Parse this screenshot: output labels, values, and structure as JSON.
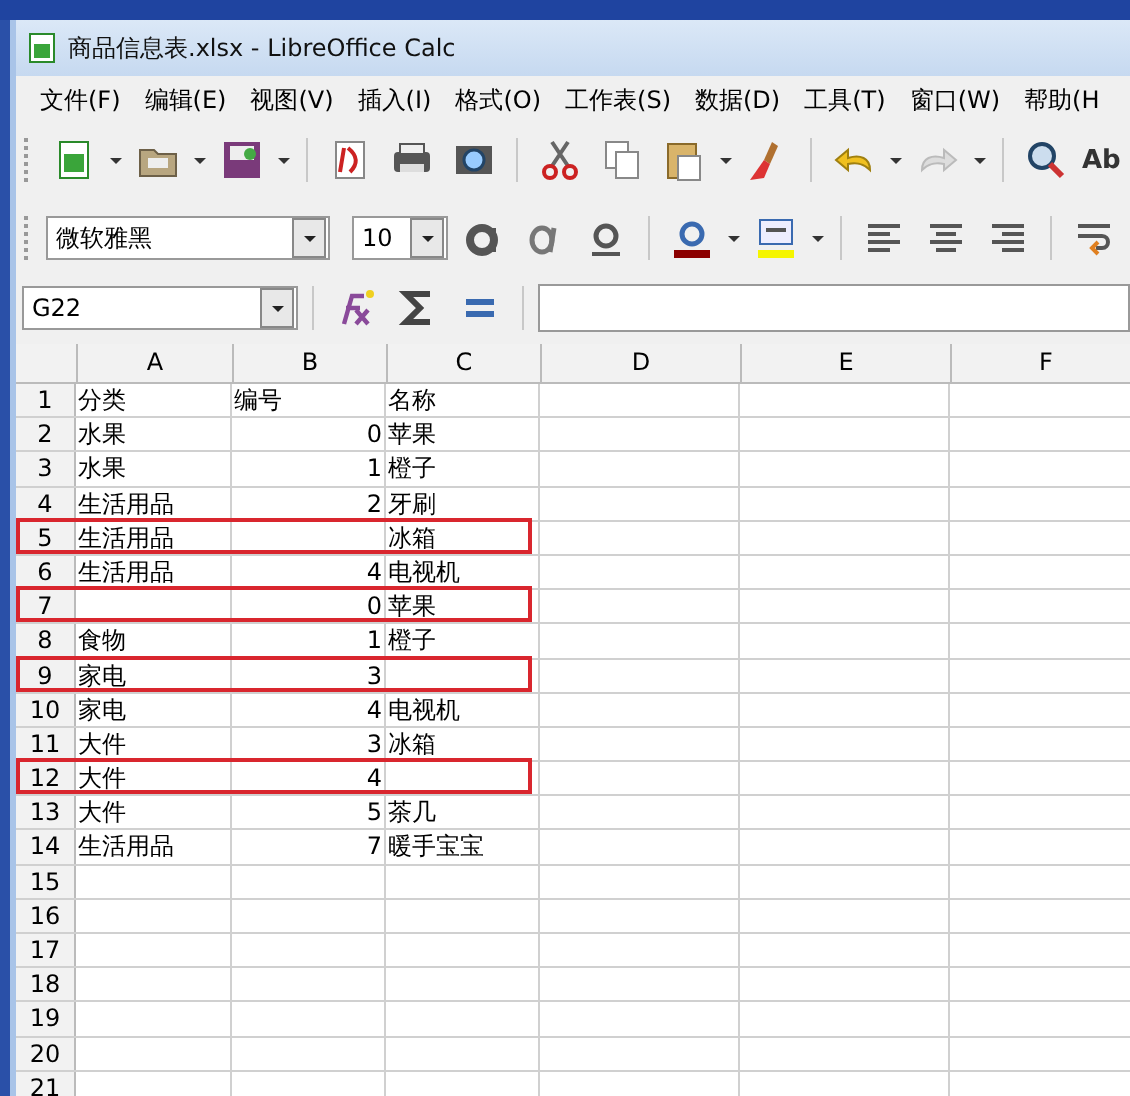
{
  "window": {
    "title": "商品信息表.xlsx - LibreOffice Calc"
  },
  "menu": [
    "文件(F)",
    "编辑(E)",
    "视图(V)",
    "插入(I)",
    "格式(O)",
    "工作表(S)",
    "数据(D)",
    "工具(T)",
    "窗口(W)",
    "帮助(H"
  ],
  "toolbar": {
    "spellcheck_text": "Ab"
  },
  "format_bar": {
    "font_name": "微软雅黑",
    "font_size": "10"
  },
  "formula_bar": {
    "name_box": "G22"
  },
  "sheet": {
    "columns": [
      "A",
      "B",
      "C",
      "D",
      "E",
      "F"
    ],
    "rows": [
      {
        "number": "1",
        "cells": [
          "分类",
          "编号",
          "名称"
        ],
        "marked": false
      },
      {
        "number": "2",
        "cells": [
          "水果",
          "0",
          "苹果"
        ],
        "marked": false
      },
      {
        "number": "3",
        "cells": [
          "水果",
          "1",
          "橙子"
        ],
        "marked": false
      },
      {
        "number": "4",
        "cells": [
          "生活用品",
          "2",
          "牙刷"
        ],
        "marked": false
      },
      {
        "number": "5",
        "cells": [
          "生活用品",
          "",
          "冰箱"
        ],
        "marked": true
      },
      {
        "number": "6",
        "cells": [
          "生活用品",
          "4",
          "电视机"
        ],
        "marked": false
      },
      {
        "number": "7",
        "cells": [
          "",
          "0",
          "苹果"
        ],
        "marked": true
      },
      {
        "number": "8",
        "cells": [
          "食物",
          "1",
          "橙子"
        ],
        "marked": false
      },
      {
        "number": "9",
        "cells": [
          "家电",
          "3",
          ""
        ],
        "marked": true
      },
      {
        "number": "10",
        "cells": [
          "家电",
          "4",
          "电视机"
        ],
        "marked": false
      },
      {
        "number": "11",
        "cells": [
          "大件",
          "3",
          "冰箱"
        ],
        "marked": false
      },
      {
        "number": "12",
        "cells": [
          "大件",
          "4",
          ""
        ],
        "marked": true
      },
      {
        "number": "13",
        "cells": [
          "大件",
          "5",
          "茶几"
        ],
        "marked": false
      },
      {
        "number": "14",
        "cells": [
          "生活用品",
          "7",
          "暖手宝宝"
        ],
        "marked": false
      },
      {
        "number": "15",
        "cells": [
          "",
          "",
          ""
        ],
        "marked": false
      },
      {
        "number": "16",
        "cells": [
          "",
          "",
          ""
        ],
        "marked": false
      },
      {
        "number": "17",
        "cells": [
          "",
          "",
          ""
        ],
        "marked": false
      },
      {
        "number": "18",
        "cells": [
          "",
          "",
          ""
        ],
        "marked": false
      },
      {
        "number": "19",
        "cells": [
          "",
          "",
          ""
        ],
        "marked": false
      },
      {
        "number": "20",
        "cells": [
          "",
          "",
          ""
        ],
        "marked": false
      },
      {
        "number": "21",
        "cells": [
          "",
          "",
          ""
        ],
        "marked": false
      }
    ]
  }
}
